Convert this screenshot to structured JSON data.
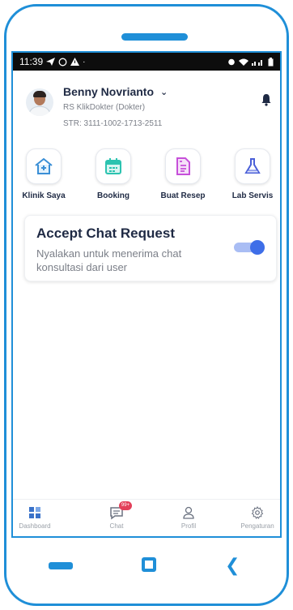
{
  "status_bar": {
    "time": "11:39",
    "icons_left": [
      "send-icon",
      "whatsapp-icon",
      "warning-icon",
      "dot-icon"
    ],
    "icons_right": [
      "alarm-icon",
      "wifi-icon",
      "signal-icon",
      "battery-icon"
    ]
  },
  "profile": {
    "name": "Benny Novrianto",
    "hospital": "RS KlikDokter (Dokter)",
    "str": "STR: 3111-1002-1713-2511"
  },
  "menu": [
    {
      "label": "Klinik Saya",
      "icon": "clinic-icon",
      "color": "#3a8fd6"
    },
    {
      "label": "Booking",
      "icon": "calendar-icon",
      "color": "#2cc3b0"
    },
    {
      "label": "Buat Resep",
      "icon": "prescription-icon",
      "color": "#c64fd9"
    },
    {
      "label": "Lab Servis",
      "icon": "lab-flask-icon",
      "color": "#4a5fd8"
    }
  ],
  "chat_request": {
    "title": "Accept Chat Request",
    "description": "Nyalakan untuk menerima chat konsultasi dari user",
    "enabled": true
  },
  "bottom_nav": [
    {
      "label": "Dashboard",
      "icon": "dashboard-icon"
    },
    {
      "label": "Chat",
      "icon": "chat-icon",
      "badge": "99+"
    },
    {
      "label": "Profil",
      "icon": "user-icon"
    },
    {
      "label": "Pengaturan",
      "icon": "gear-icon"
    }
  ],
  "colors": {
    "frame": "#1f8fd8",
    "accent": "#3e6ee8",
    "badge": "#e3405a"
  }
}
